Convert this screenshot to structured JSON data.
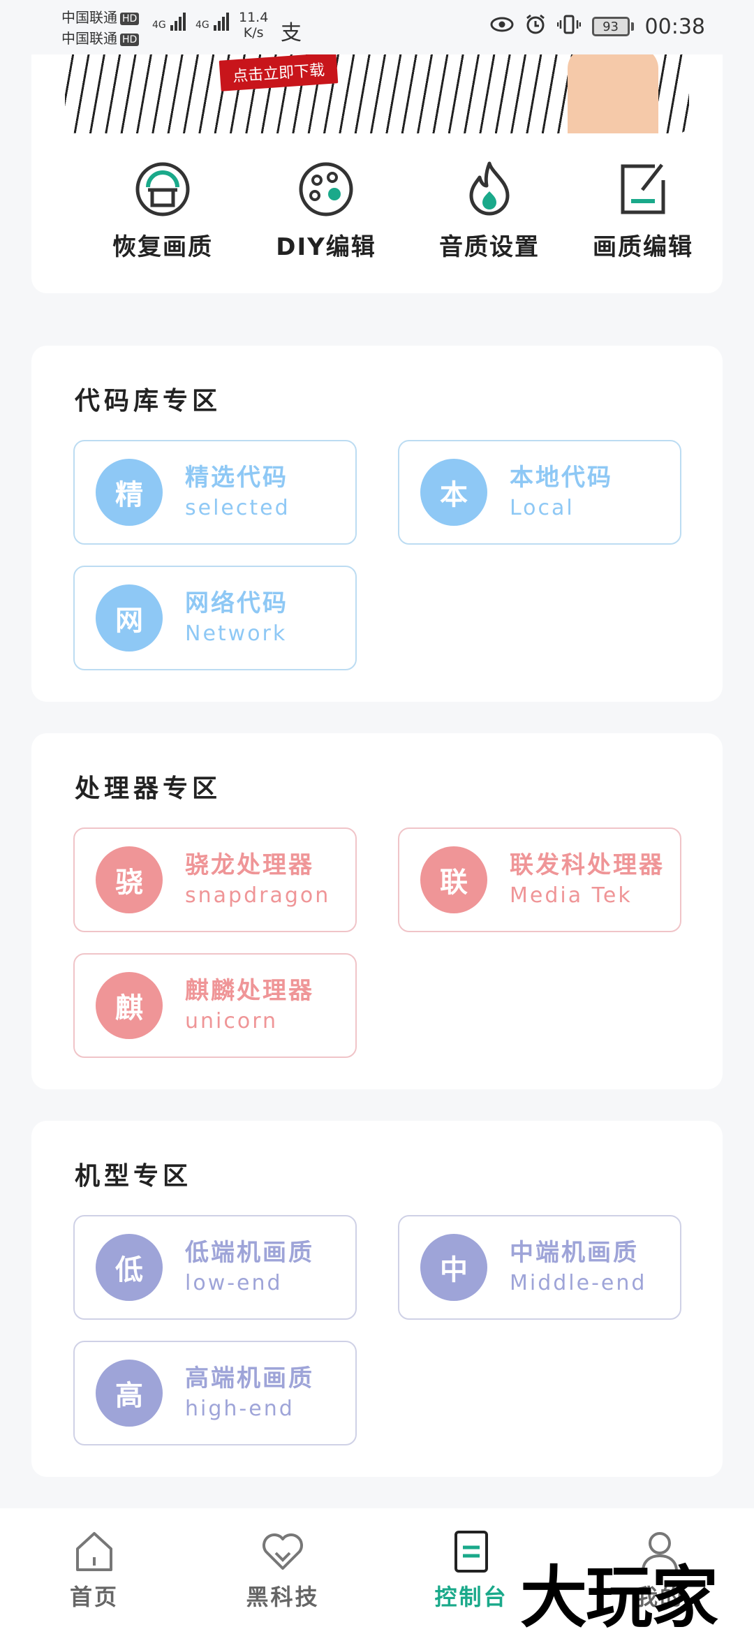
{
  "status_bar": {
    "carrier1": "中国联通",
    "carrier2": "中国联通",
    "hd": "HD",
    "net1": "4G",
    "net2": "4G",
    "speed_value": "11.4",
    "speed_unit": "K/s",
    "battery": "93",
    "time": "00:38"
  },
  "banner": {
    "button_label": "点击立即下载"
  },
  "quick_actions": [
    {
      "label": "恢复画质",
      "icon": "restore-quality-icon"
    },
    {
      "label": "DIY编辑",
      "icon": "palette-icon"
    },
    {
      "label": "音质设置",
      "icon": "flame-icon"
    },
    {
      "label": "画质编辑",
      "icon": "edit-icon"
    }
  ],
  "sections": {
    "code": {
      "title": "代码库专区",
      "items": [
        {
          "char": "精",
          "title": "精选代码",
          "subtitle": "selected"
        },
        {
          "char": "本",
          "title": "本地代码",
          "subtitle": "Local"
        },
        {
          "char": "网",
          "title": "网络代码",
          "subtitle": "Network"
        }
      ],
      "color": "#8ec8f5"
    },
    "processor": {
      "title": "处理器专区",
      "items": [
        {
          "char": "骁",
          "title": "骁龙处理器",
          "subtitle": "snapdragon"
        },
        {
          "char": "联",
          "title": "联发科处理器",
          "subtitle": "Media Tek"
        },
        {
          "char": "麒",
          "title": "麒麟处理器",
          "subtitle": "unicorn"
        }
      ],
      "color": "#ef9597"
    },
    "model": {
      "title": "机型专区",
      "items": [
        {
          "char": "低",
          "title": "低端机画质",
          "subtitle": "low-end"
        },
        {
          "char": "中",
          "title": "中端机画质",
          "subtitle": "Middle-end"
        },
        {
          "char": "高",
          "title": "高端机画质",
          "subtitle": "high-end"
        }
      ],
      "color": "#9ea4d8"
    }
  },
  "bottom_nav": {
    "items": [
      {
        "label": "首页",
        "icon": "home-icon"
      },
      {
        "label": "黑科技",
        "icon": "heart-icon"
      },
      {
        "label": "控制台",
        "icon": "console-icon",
        "active": true
      },
      {
        "label": "我的",
        "icon": "user-icon"
      }
    ],
    "accent": "#1aa98a"
  },
  "watermark": "大玩家"
}
